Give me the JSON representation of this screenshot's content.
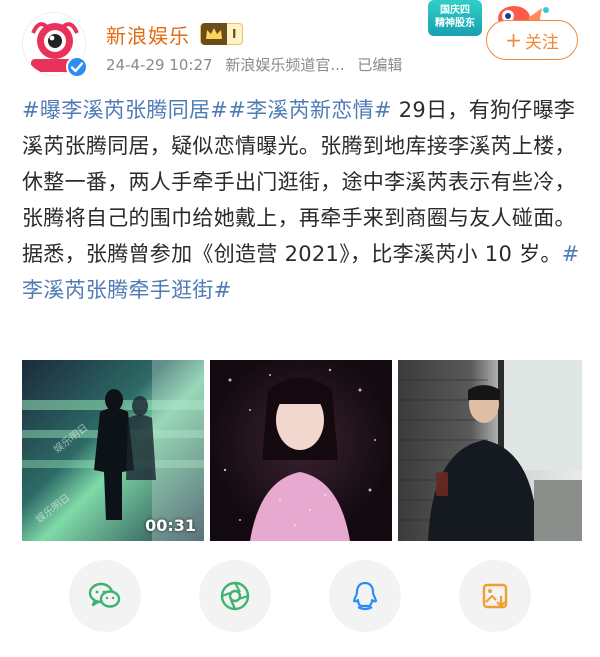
{
  "header": {
    "account_name": "新浪娱乐",
    "vip_level": "I",
    "timestamp": "24-4-29 10:27",
    "source": "新浪娱乐频道官...",
    "edited": "已编辑",
    "follow_label": "关注",
    "promo_text_line1": "国庆四",
    "promo_text_line2": "精神股东"
  },
  "post": {
    "tag1": "#曝李溪芮张腾同居#",
    "tag2": "#李溪芮新恋情#",
    "text": " 29日，有狗仔曝李溪芮张腾同居，疑似恋情曝光。张腾到地库接李溪芮上楼，休整一番，两人手牵手出门逛街，途中李溪芮表示有些冷，张腾将自己的围巾给她戴上，再牵手来到商圈与友人碰面。据悉，张腾曾参加《创造营 2021》，比李溪芮小 10 岁。",
    "tag3": "#李溪芮张腾牵手逛街#"
  },
  "media": {
    "video_duration": "00:31",
    "watermark": "娱乐明日"
  },
  "share": {
    "icons": [
      "wechat-icon",
      "moments-icon",
      "qq-icon",
      "save-image-icon"
    ]
  },
  "colors": {
    "accent_orange": "#e56b12",
    "tag_blue": "#4f7bb5",
    "follow_orange": "#f08a3a"
  }
}
